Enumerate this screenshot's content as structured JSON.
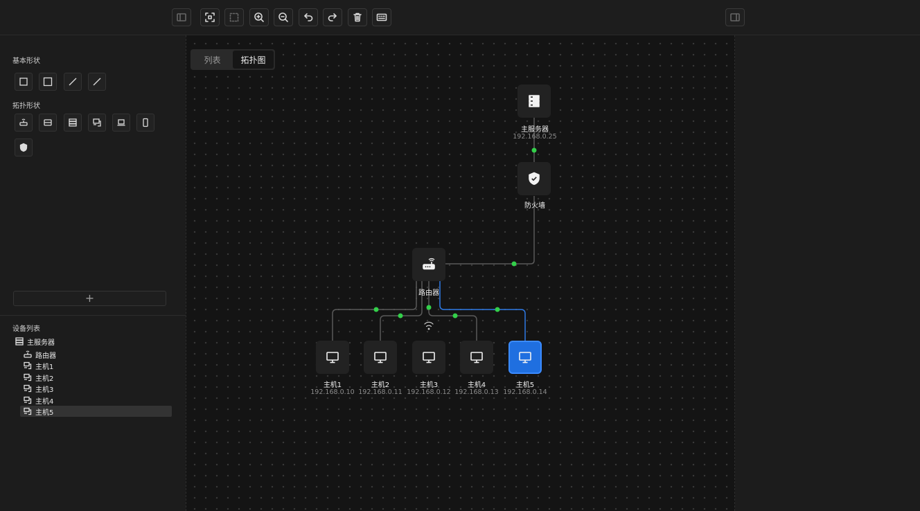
{
  "toolbar": {
    "buttons": [
      {
        "icon": "sidebar-left-icon"
      },
      {
        "icon": "fit-view-icon"
      },
      {
        "icon": "select-area-icon"
      },
      {
        "icon": "zoom-in-icon"
      },
      {
        "icon": "zoom-out-icon"
      },
      {
        "icon": "undo-icon"
      },
      {
        "icon": "redo-icon"
      },
      {
        "icon": "delete-icon"
      },
      {
        "icon": "keyboard-icon"
      },
      {
        "icon": "sidebar-right-icon"
      }
    ]
  },
  "left_panel": {
    "basic_shapes_title": "基本形状",
    "topo_shapes_title": "拓扑形状",
    "add_label": "+",
    "device_list_title": "设备列表",
    "tree": [
      {
        "label": "主服务器",
        "icon": "server-icon"
      },
      {
        "label": "路由器",
        "icon": "router-icon"
      },
      {
        "label": "主机1",
        "icon": "host-icon"
      },
      {
        "label": "主机2",
        "icon": "host-icon"
      },
      {
        "label": "主机3",
        "icon": "host-icon"
      },
      {
        "label": "主机4",
        "icon": "host-icon"
      },
      {
        "label": "主机5",
        "icon": "host-icon",
        "selected": true
      }
    ]
  },
  "canvas": {
    "tabs": [
      "列表",
      "拓扑图"
    ],
    "active_tab": "拓扑图",
    "nodes": {
      "server": {
        "label": "主服务器",
        "ip": "192.168.0.25"
      },
      "firewall": {
        "label": "防火墙"
      },
      "router": {
        "label": "路由器"
      },
      "host1": {
        "label": "主机1",
        "ip": "192.168.0.10"
      },
      "host2": {
        "label": "主机2",
        "ip": "192.168.0.11"
      },
      "host3": {
        "label": "主机3",
        "ip": "192.168.0.12"
      },
      "host4": {
        "label": "主机4",
        "ip": "192.168.0.13"
      },
      "host5": {
        "label": "主机5",
        "ip": "192.168.0.14",
        "selected": true
      }
    },
    "colors": {
      "link": "#5a5a5a",
      "selected_link": "#2f7be6",
      "connector_dot": "#33d04a",
      "selected_node": "#1f6fe0"
    }
  }
}
